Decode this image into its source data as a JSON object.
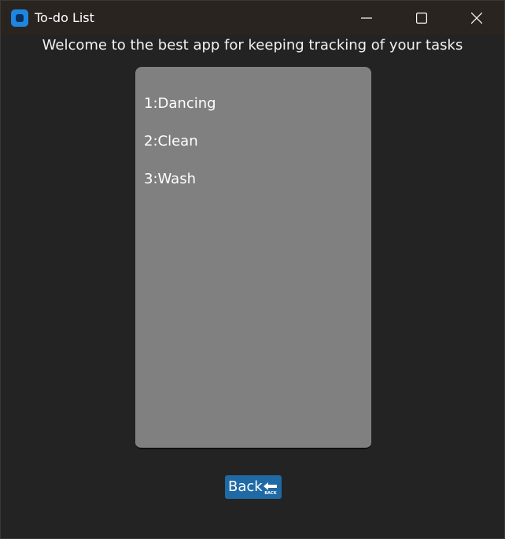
{
  "window": {
    "title": "To-do List",
    "app_icon": "app-icon"
  },
  "window_controls": {
    "minimize_icon": "minimize-icon",
    "maximize_icon": "maximize-icon",
    "close_icon": "close-icon"
  },
  "main": {
    "welcome": "Welcome to the best app for keeping tracking of your tasks",
    "tasks": [
      {
        "label": "1:Dancing"
      },
      {
        "label": "2:Clean"
      },
      {
        "label": "3:Wash"
      }
    ]
  },
  "back_button": {
    "label": "Back",
    "icon": "back-arrow-icon",
    "icon_text": "BACK"
  },
  "colors": {
    "window_bg": "#232323",
    "titlebar_bg": "#2a2421",
    "panel_bg": "#808080",
    "button_bg": "#1f6aa5",
    "accent": "#1e86e0"
  }
}
